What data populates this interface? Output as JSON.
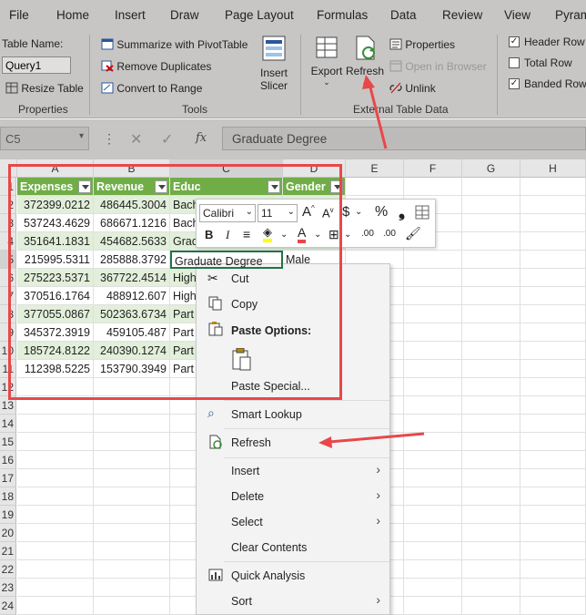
{
  "menu_tabs": [
    "File",
    "Home",
    "Insert",
    "Draw",
    "Page Layout",
    "Formulas",
    "Data",
    "Review",
    "View",
    "Pyram"
  ],
  "ribbon": {
    "properties": {
      "table_name_label": "Table Name:",
      "table_name_value": "Query1",
      "resize_table": "Resize Table",
      "group_label": "Properties"
    },
    "tools": {
      "summarize": "Summarize with PivotTable",
      "remove_duplicates": "Remove Duplicates",
      "convert_to_range": "Convert to Range",
      "insert_slicer_1": "Insert",
      "insert_slicer_2": "Slicer",
      "group_label": "Tools"
    },
    "external": {
      "export": "Export",
      "refresh": "Refresh",
      "properties": "Properties",
      "open_in_browser": "Open in Browser",
      "unlink": "Unlink",
      "group_label": "External Table Data"
    },
    "style_options": {
      "header_row": "Header Row",
      "total_row": "Total Row",
      "banded_rows": "Banded Rows",
      "header_row_checked": true,
      "total_row_checked": false,
      "banded_rows_checked": true
    }
  },
  "formula_bar": {
    "name_box": "C5",
    "fx": "fx",
    "content": "Graduate Degree"
  },
  "grid": {
    "columns": [
      "A",
      "B",
      "C",
      "D",
      "E",
      "F",
      "G",
      "H"
    ],
    "rows": [
      "1",
      "2",
      "3",
      "4",
      "5",
      "6",
      "7",
      "8",
      "9",
      "10",
      "11",
      "12",
      "13",
      "14",
      "15",
      "16",
      "17",
      "18",
      "19",
      "20",
      "21",
      "22",
      "23",
      "24"
    ],
    "table_headers": [
      "Expenses",
      "Revenue",
      "Educ",
      "Gender"
    ],
    "data": [
      [
        "372399.0212",
        "486445.3004",
        "Bach",
        ""
      ],
      [
        "537243.4629",
        "686671.1216",
        "Bach",
        ""
      ],
      [
        "351641.1831",
        "454682.5633",
        "Grad",
        ""
      ],
      [
        "215995.5311",
        "285888.3792",
        "Graduate Degree",
        "Male"
      ],
      [
        "275223.5371",
        "367722.4514",
        "High",
        ""
      ],
      [
        "370516.1764",
        "488912.607",
        "High",
        ""
      ],
      [
        "377055.0867",
        "502363.6734",
        "Part",
        ""
      ],
      [
        "345372.3919",
        "459105.487",
        "Part",
        ""
      ],
      [
        "185724.8122",
        "240390.1274",
        "Part",
        ""
      ],
      [
        "112398.5225",
        "153790.3949",
        "Part",
        ""
      ]
    ]
  },
  "mini_toolbar": {
    "font": "Calibri",
    "size": "11",
    "currency": "$",
    "percent": "%",
    "comma": "9",
    "bold": "B",
    "italic": "I",
    "font_color": "A",
    "inc_dec": ".00",
    "dec_dec": ".00"
  },
  "context_menu": {
    "cut": "Cut",
    "copy": "Copy",
    "paste_options": "Paste Options:",
    "paste_special": "Paste Special...",
    "smart_lookup": "Smart Lookup",
    "refresh": "Refresh",
    "insert": "Insert",
    "delete": "Delete",
    "select": "Select",
    "clear_contents": "Clear Contents",
    "quick_analysis": "Quick Analysis",
    "sort": "Sort"
  },
  "colors": {
    "accent_red": "#e8474a",
    "table_header_green": "#70ad47",
    "band_green": "#e2efda"
  }
}
